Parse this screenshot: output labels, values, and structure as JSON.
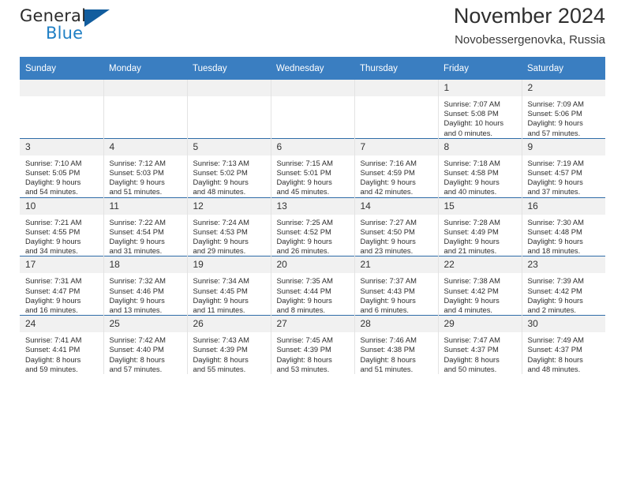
{
  "brand": {
    "name_part1": "General",
    "name_part2": "Blue"
  },
  "header": {
    "title": "November 2024",
    "subtitle": "Novobessergenovka, Russia"
  },
  "colors": {
    "header_blue": "#3a7ec1",
    "row_rule_blue": "#2f6ca8",
    "daynum_band": "#f1f1f1",
    "logo_blue": "#1f7fc4",
    "logo_triangle": "#125d9e"
  },
  "weekday_headers": [
    "Sunday",
    "Monday",
    "Tuesday",
    "Wednesday",
    "Thursday",
    "Friday",
    "Saturday"
  ],
  "weeks": [
    [
      {
        "day": "",
        "lines": []
      },
      {
        "day": "",
        "lines": []
      },
      {
        "day": "",
        "lines": []
      },
      {
        "day": "",
        "lines": []
      },
      {
        "day": "",
        "lines": []
      },
      {
        "day": "1",
        "lines": [
          "Sunrise: 7:07 AM",
          "Sunset: 5:08 PM",
          "Daylight: 10 hours",
          "and 0 minutes."
        ]
      },
      {
        "day": "2",
        "lines": [
          "Sunrise: 7:09 AM",
          "Sunset: 5:06 PM",
          "Daylight: 9 hours",
          "and 57 minutes."
        ]
      }
    ],
    [
      {
        "day": "3",
        "lines": [
          "Sunrise: 7:10 AM",
          "Sunset: 5:05 PM",
          "Daylight: 9 hours",
          "and 54 minutes."
        ]
      },
      {
        "day": "4",
        "lines": [
          "Sunrise: 7:12 AM",
          "Sunset: 5:03 PM",
          "Daylight: 9 hours",
          "and 51 minutes."
        ]
      },
      {
        "day": "5",
        "lines": [
          "Sunrise: 7:13 AM",
          "Sunset: 5:02 PM",
          "Daylight: 9 hours",
          "and 48 minutes."
        ]
      },
      {
        "day": "6",
        "lines": [
          "Sunrise: 7:15 AM",
          "Sunset: 5:01 PM",
          "Daylight: 9 hours",
          "and 45 minutes."
        ]
      },
      {
        "day": "7",
        "lines": [
          "Sunrise: 7:16 AM",
          "Sunset: 4:59 PM",
          "Daylight: 9 hours",
          "and 42 minutes."
        ]
      },
      {
        "day": "8",
        "lines": [
          "Sunrise: 7:18 AM",
          "Sunset: 4:58 PM",
          "Daylight: 9 hours",
          "and 40 minutes."
        ]
      },
      {
        "day": "9",
        "lines": [
          "Sunrise: 7:19 AM",
          "Sunset: 4:57 PM",
          "Daylight: 9 hours",
          "and 37 minutes."
        ]
      }
    ],
    [
      {
        "day": "10",
        "lines": [
          "Sunrise: 7:21 AM",
          "Sunset: 4:55 PM",
          "Daylight: 9 hours",
          "and 34 minutes."
        ]
      },
      {
        "day": "11",
        "lines": [
          "Sunrise: 7:22 AM",
          "Sunset: 4:54 PM",
          "Daylight: 9 hours",
          "and 31 minutes."
        ]
      },
      {
        "day": "12",
        "lines": [
          "Sunrise: 7:24 AM",
          "Sunset: 4:53 PM",
          "Daylight: 9 hours",
          "and 29 minutes."
        ]
      },
      {
        "day": "13",
        "lines": [
          "Sunrise: 7:25 AM",
          "Sunset: 4:52 PM",
          "Daylight: 9 hours",
          "and 26 minutes."
        ]
      },
      {
        "day": "14",
        "lines": [
          "Sunrise: 7:27 AM",
          "Sunset: 4:50 PM",
          "Daylight: 9 hours",
          "and 23 minutes."
        ]
      },
      {
        "day": "15",
        "lines": [
          "Sunrise: 7:28 AM",
          "Sunset: 4:49 PM",
          "Daylight: 9 hours",
          "and 21 minutes."
        ]
      },
      {
        "day": "16",
        "lines": [
          "Sunrise: 7:30 AM",
          "Sunset: 4:48 PM",
          "Daylight: 9 hours",
          "and 18 minutes."
        ]
      }
    ],
    [
      {
        "day": "17",
        "lines": [
          "Sunrise: 7:31 AM",
          "Sunset: 4:47 PM",
          "Daylight: 9 hours",
          "and 16 minutes."
        ]
      },
      {
        "day": "18",
        "lines": [
          "Sunrise: 7:32 AM",
          "Sunset: 4:46 PM",
          "Daylight: 9 hours",
          "and 13 minutes."
        ]
      },
      {
        "day": "19",
        "lines": [
          "Sunrise: 7:34 AM",
          "Sunset: 4:45 PM",
          "Daylight: 9 hours",
          "and 11 minutes."
        ]
      },
      {
        "day": "20",
        "lines": [
          "Sunrise: 7:35 AM",
          "Sunset: 4:44 PM",
          "Daylight: 9 hours",
          "and 8 minutes."
        ]
      },
      {
        "day": "21",
        "lines": [
          "Sunrise: 7:37 AM",
          "Sunset: 4:43 PM",
          "Daylight: 9 hours",
          "and 6 minutes."
        ]
      },
      {
        "day": "22",
        "lines": [
          "Sunrise: 7:38 AM",
          "Sunset: 4:42 PM",
          "Daylight: 9 hours",
          "and 4 minutes."
        ]
      },
      {
        "day": "23",
        "lines": [
          "Sunrise: 7:39 AM",
          "Sunset: 4:42 PM",
          "Daylight: 9 hours",
          "and 2 minutes."
        ]
      }
    ],
    [
      {
        "day": "24",
        "lines": [
          "Sunrise: 7:41 AM",
          "Sunset: 4:41 PM",
          "Daylight: 8 hours",
          "and 59 minutes."
        ]
      },
      {
        "day": "25",
        "lines": [
          "Sunrise: 7:42 AM",
          "Sunset: 4:40 PM",
          "Daylight: 8 hours",
          "and 57 minutes."
        ]
      },
      {
        "day": "26",
        "lines": [
          "Sunrise: 7:43 AM",
          "Sunset: 4:39 PM",
          "Daylight: 8 hours",
          "and 55 minutes."
        ]
      },
      {
        "day": "27",
        "lines": [
          "Sunrise: 7:45 AM",
          "Sunset: 4:39 PM",
          "Daylight: 8 hours",
          "and 53 minutes."
        ]
      },
      {
        "day": "28",
        "lines": [
          "Sunrise: 7:46 AM",
          "Sunset: 4:38 PM",
          "Daylight: 8 hours",
          "and 51 minutes."
        ]
      },
      {
        "day": "29",
        "lines": [
          "Sunrise: 7:47 AM",
          "Sunset: 4:37 PM",
          "Daylight: 8 hours",
          "and 50 minutes."
        ]
      },
      {
        "day": "30",
        "lines": [
          "Sunrise: 7:49 AM",
          "Sunset: 4:37 PM",
          "Daylight: 8 hours",
          "and 48 minutes."
        ]
      }
    ]
  ]
}
